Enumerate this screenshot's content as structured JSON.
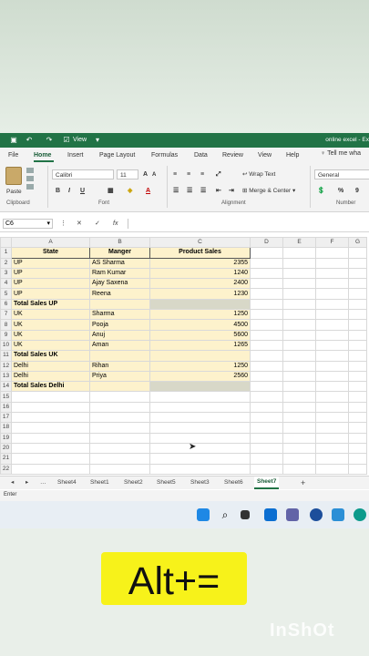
{
  "app": {
    "title": "online excel - Ex",
    "view_label": "View"
  },
  "menu": {
    "tabs": [
      "File",
      "Home",
      "Insert",
      "Page Layout",
      "Formulas",
      "Data",
      "Review",
      "View",
      "Help"
    ],
    "tell_me": "Tell me wha"
  },
  "ribbon": {
    "paste_label": "Paste",
    "clipboard_label": "Clipboard",
    "font_name": "Calibri",
    "font_size": "11",
    "font_label": "Font",
    "bold": "B",
    "italic": "I",
    "underline": "U",
    "wrap_text": "Wrap Text",
    "merge_center": "Merge & Center",
    "alignment_label": "Alignment",
    "number_format": "General",
    "percent": "%",
    "number_label": "Number"
  },
  "formula_bar": {
    "name_box": "C6",
    "cancel": "✕",
    "enter": "✓",
    "fx": "fx",
    "value": ""
  },
  "grid": {
    "columns": [
      "A",
      "B",
      "C",
      "D",
      "E",
      "F",
      "G"
    ],
    "headers": [
      "State",
      "Manger",
      "Product Sales"
    ],
    "rows": [
      {
        "n": "1",
        "a": "State",
        "b": "Manger",
        "c": "Product Sales"
      },
      {
        "n": "2",
        "a": "UP",
        "b": "AS Sharma",
        "c": "2355"
      },
      {
        "n": "3",
        "a": "UP",
        "b": "Ram Kumar",
        "c": "1240"
      },
      {
        "n": "4",
        "a": "UP",
        "b": "Ajay Saxena",
        "c": "2400"
      },
      {
        "n": "5",
        "a": "UP",
        "b": "Reena",
        "c": "1230"
      },
      {
        "n": "6",
        "a": "Total Sales  UP",
        "b": "",
        "c": ""
      },
      {
        "n": "7",
        "a": "UK",
        "b": "Sharma",
        "c": "1250"
      },
      {
        "n": "8",
        "a": "UK",
        "b": "Pooja",
        "c": "4500"
      },
      {
        "n": "9",
        "a": "UK",
        "b": "Anuj",
        "c": "5600"
      },
      {
        "n": "10",
        "a": "UK",
        "b": "Aman",
        "c": "1265"
      },
      {
        "n": "11",
        "a": "Total Sales  UK",
        "b": "",
        "c": ""
      },
      {
        "n": "12",
        "a": "Delhi",
        "b": "Rihan",
        "c": "1250"
      },
      {
        "n": "13",
        "a": "Delhi",
        "b": "Priya",
        "c": "2560"
      },
      {
        "n": "14",
        "a": "Total Sales Delhi",
        "b": "",
        "c": ""
      },
      {
        "n": "15",
        "a": "",
        "b": "",
        "c": ""
      },
      {
        "n": "16",
        "a": "",
        "b": "",
        "c": ""
      },
      {
        "n": "17",
        "a": "",
        "b": "",
        "c": ""
      },
      {
        "n": "18",
        "a": "",
        "b": "",
        "c": ""
      },
      {
        "n": "19",
        "a": "",
        "b": "",
        "c": ""
      },
      {
        "n": "20",
        "a": "",
        "b": "",
        "c": ""
      },
      {
        "n": "21",
        "a": "",
        "b": "",
        "c": ""
      },
      {
        "n": "22",
        "a": "",
        "b": "",
        "c": ""
      }
    ]
  },
  "sheets": {
    "tabs": [
      "Sheet4",
      "Sheet1",
      "Sheet2",
      "Sheet5",
      "Sheet3",
      "Sheet6",
      "Sheet7"
    ],
    "active": "Sheet7",
    "add": "+"
  },
  "status": {
    "mode": "Enter"
  },
  "overlay": {
    "hotkey": "Alt+=",
    "watermark": "InShOt"
  }
}
